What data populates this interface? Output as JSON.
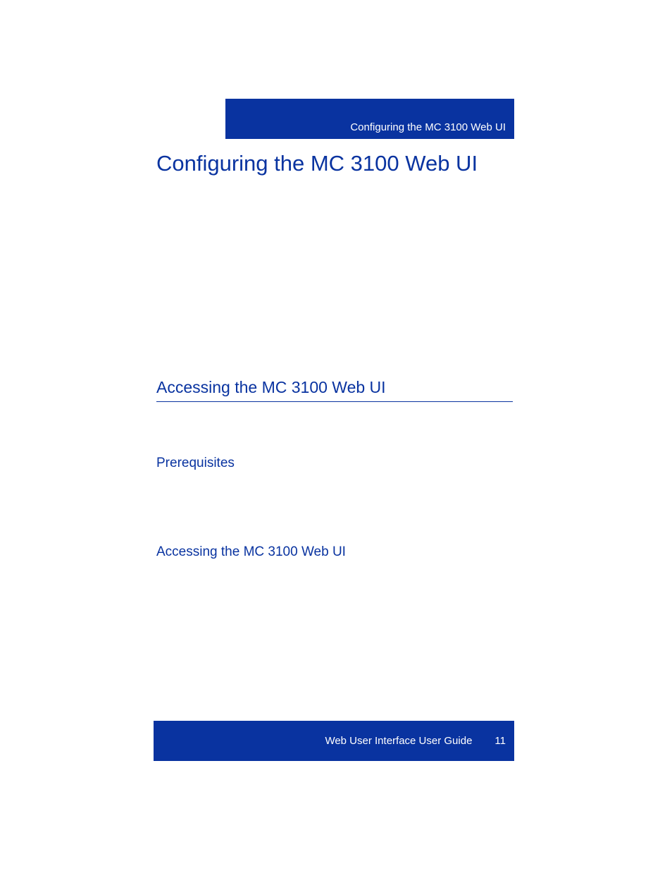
{
  "header": {
    "band_text": "Configuring the MC 3100 Web UI"
  },
  "chapter": {
    "title": "Configuring the MC 3100 Web UI"
  },
  "section": {
    "heading": "Accessing the MC 3100 Web UI"
  },
  "subsections": {
    "prerequisites": "Prerequisites",
    "accessing": "Accessing the MC 3100 Web UI"
  },
  "footer": {
    "guide_name": "Web User Interface User Guide",
    "page_number": "11"
  }
}
